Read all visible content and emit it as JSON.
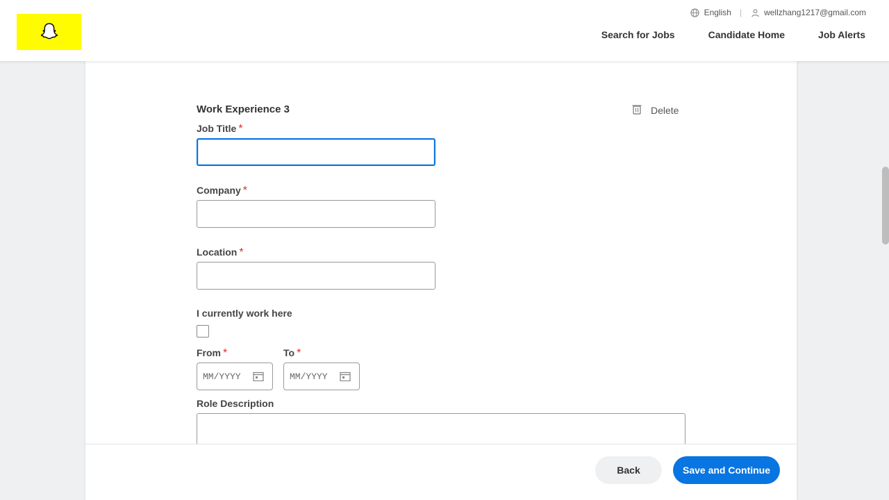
{
  "header": {
    "language": "English",
    "user_email": "wellzhang1217@gmail.com",
    "nav": {
      "search_jobs": "Search for Jobs",
      "candidate_home": "Candidate Home",
      "job_alerts": "Job Alerts"
    }
  },
  "form": {
    "section_title": "Work Experience 3",
    "delete_label": "Delete",
    "job_title_label": "Job Title",
    "company_label": "Company",
    "location_label": "Location",
    "currently_work_label": "I currently work here",
    "from_label": "From",
    "to_label": "To",
    "date_placeholder": "MM/YYYY",
    "description_label": "Role Description",
    "required_mark": "*",
    "job_title_value": "",
    "company_value": "",
    "location_value": ""
  },
  "footer": {
    "back_label": "Back",
    "save_label": "Save and Continue"
  },
  "colors": {
    "brand_yellow": "#fffc00",
    "primary_blue": "#0875e1",
    "required_red": "#de2e21"
  }
}
